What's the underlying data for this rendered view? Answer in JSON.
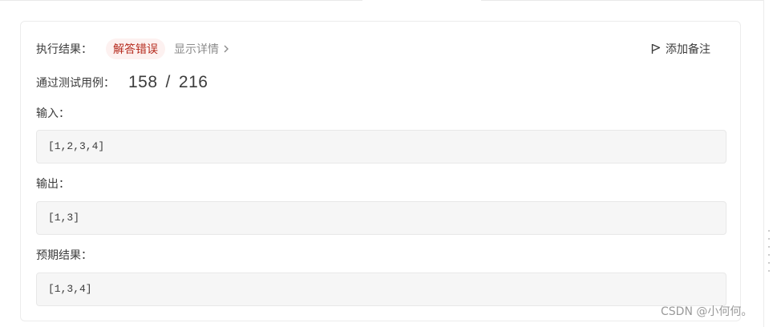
{
  "result": {
    "label": "执行结果：",
    "status": "解答错误",
    "details_link": "显示详情",
    "note_button": "添加备注",
    "status_color": "#b52a1d"
  },
  "tests": {
    "label": "通过测试用例：",
    "passed": "158",
    "separator": "/",
    "total": "216"
  },
  "input": {
    "label": "输入：",
    "value": "[1,2,3,4]"
  },
  "output": {
    "label": "输出：",
    "value": "[1,3]"
  },
  "expected": {
    "label": "预期结果：",
    "value": "[1,3,4]"
  },
  "watermark": "CSDN @小何何。"
}
